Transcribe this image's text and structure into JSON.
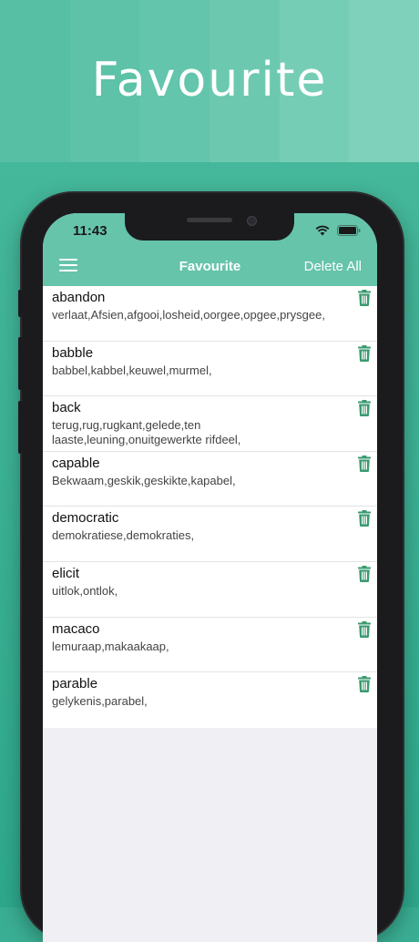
{
  "promo": {
    "title": "Favourite"
  },
  "status_bar": {
    "time": "11:43"
  },
  "nav": {
    "title": "Favourite",
    "delete_all_label": "Delete All",
    "menu_icon": "menu-icon"
  },
  "colors": {
    "header": "#66c4ab",
    "trash": "#3a9a6f",
    "background": "#3aae93"
  },
  "items": [
    {
      "word": "abandon",
      "meaning": "verlaat,Afsien,afgooi,losheid,oorgee,opgee,prysgee,"
    },
    {
      "word": "babble",
      "meaning": "babbel,kabbel,keuwel,murmel,"
    },
    {
      "word": "back",
      "meaning": "terug,rug,rugkant,gelede,ten laaste,leuning,onuitgewerkte rifdeel,"
    },
    {
      "word": "capable",
      "meaning": "Bekwaam,geskik,geskikte,kapabel,"
    },
    {
      "word": "democratic",
      "meaning": "demokratiese,demokraties,"
    },
    {
      "word": "elicit",
      "meaning": "uitlok,ontlok,"
    },
    {
      "word": "macaco",
      "meaning": "lemuraap,makaakaap,"
    },
    {
      "word": "parable",
      "meaning": "gelykenis,parabel,"
    }
  ]
}
